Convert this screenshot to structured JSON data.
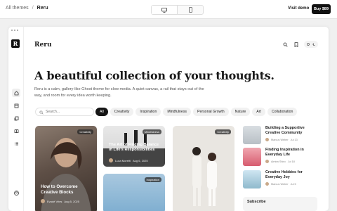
{
  "topbar": {
    "breadcrumb_root": "All themes",
    "breadcrumb_sep": "/",
    "breadcrumb_current": "Reru",
    "devices": [
      "desktop-icon",
      "mobile-icon"
    ],
    "visit_label": "Visit demo",
    "buy_label": "Buy $89"
  },
  "rail": {
    "logo_letter": "R",
    "items": [
      "home-icon",
      "archive-icon",
      "copy-icon",
      "book-icon",
      "list-icon"
    ],
    "account_icon": "user-icon"
  },
  "header": {
    "brand": "Reru",
    "icons": [
      "search-icon",
      "bookmark-icon",
      "theme-toggle-icon"
    ]
  },
  "hero": {
    "title": "A beautiful collection of your thoughts.",
    "intro": "Reru is a calm, gallery-like Ghost theme for slow media. A quiet canvas, a rail that stays out of the way, and room for every idea worth keeping."
  },
  "search": {
    "placeholder": "Search..."
  },
  "filters": [
    "All",
    "Creativity",
    "Inspiration",
    "Mindfulness",
    "Personal Growth",
    "Nature",
    "Art",
    "Collaboration"
  ],
  "active_filter": "All",
  "cards": [
    {
      "tag": "Creativity",
      "title": "How to Overcome Creative Blocks",
      "author": "Evadé Vries",
      "date": "Aug 5, 2025"
    },
    {
      "tag": "Mindfulness",
      "title": "The Art of Finding Balance in Life's Responsibilities",
      "author": "Luca Moretti",
      "date": "Aug 6, 2025"
    },
    {
      "tag": "Inspiration"
    },
    {
      "tag": "Creativity"
    }
  ],
  "sidebar_posts": [
    {
      "title": "Building a Supportive Creative Community",
      "author": "Marcus Weber",
      "date": "Jul 13"
    },
    {
      "title": "Finding Inspiration in Everyday Life",
      "author": "Almira Shiro",
      "date": "Jul 18"
    },
    {
      "title": "Creative Hobbies for Everyday Joy",
      "author": "Marcus Weber",
      "date": "Jul 5"
    }
  ],
  "subscribe": {
    "label": "Subscribe"
  },
  "colors": {
    "accent": "#151515",
    "chip_bg": "#f1f1f1",
    "page_bg": "#f0f0f0"
  }
}
